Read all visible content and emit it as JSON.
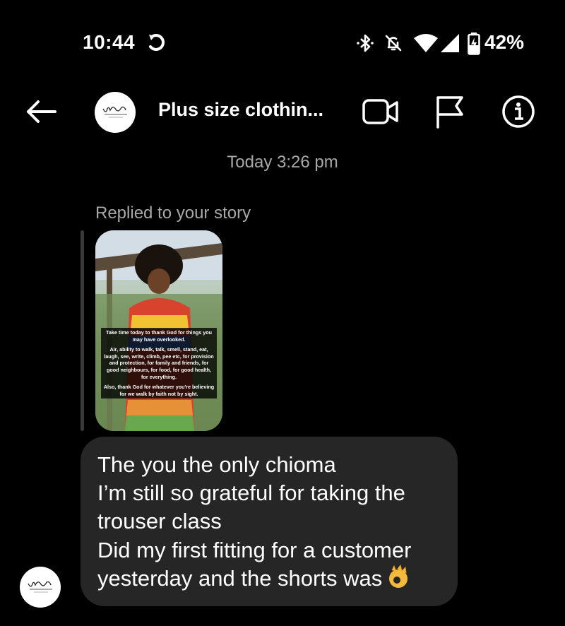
{
  "status_bar": {
    "time": "10:44",
    "battery_percent": "42%",
    "icons": [
      "sync-icon",
      "bluetooth-icon",
      "do-not-disturb-off-icon",
      "wifi-icon",
      "signal-icon",
      "battery-charging-icon"
    ]
  },
  "header": {
    "title": "Plus size clothin...",
    "avatar_logo": "Vivi Xemy",
    "icons": [
      "back-arrow-icon",
      "video-call-icon",
      "flag-icon",
      "info-icon"
    ]
  },
  "chat": {
    "timestamp": "Today 3:26 pm",
    "reply_label": "Replied to your story",
    "story": {
      "p1": "Take time today to thank God for things you may have overlooked.",
      "p2": "Air, ability to walk, talk, smell, stand, eat, laugh, see, write, climb, pee etc, for provision and protection, for family and friends, for good neighbours, for food, for good health, for everything.",
      "p3": "Also, thank God for whatever you're believing for we walk by faith not by sight."
    },
    "message": {
      "lines": [
        "The you the only chioma",
        "I’m still so grateful for taking the",
        "trouser class",
        "Did my first fitting for a customer",
        "yesterday and the shorts was"
      ],
      "emoji": "ok-hand-emoji"
    }
  },
  "colors": {
    "background": "#000000",
    "bubble": "#262626",
    "secondary_text": "#a8a8a8"
  }
}
